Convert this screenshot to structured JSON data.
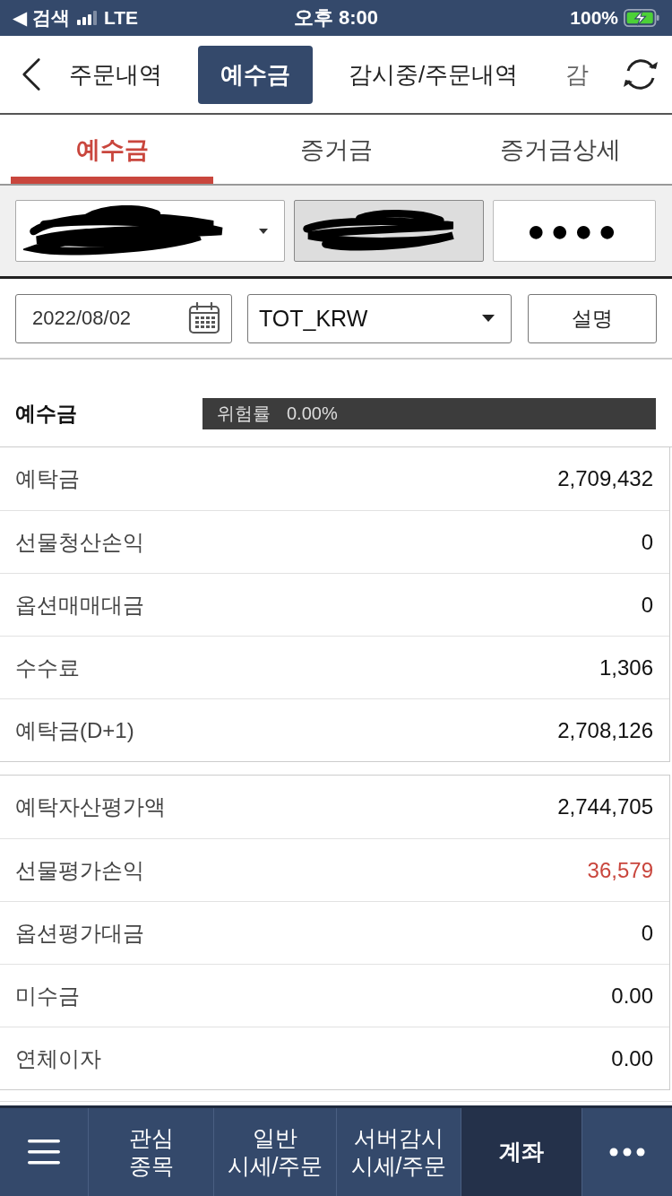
{
  "status_bar": {
    "back_label": "◀ 검색",
    "network": "LTE",
    "time": "오후 8:00",
    "battery": "100%"
  },
  "top_tabs": [
    {
      "label": "주문내역",
      "selected": false
    },
    {
      "label": "예수금",
      "selected": true
    },
    {
      "label": "감시중/주문내역",
      "selected": false
    },
    {
      "label": "감",
      "selected": false
    }
  ],
  "sub_tabs": [
    {
      "label": "예수금",
      "selected": true
    },
    {
      "label": "증거금",
      "selected": false
    },
    {
      "label": "증거금상세",
      "selected": false
    }
  ],
  "account": {
    "password": "●●●●"
  },
  "filters": {
    "date": "2022/08/02",
    "currency": "TOT_KRW",
    "help_button": "설명"
  },
  "summary": {
    "title": "예수금",
    "risk_label": "위험률",
    "risk_value": "0.00%"
  },
  "groups": [
    {
      "rows": [
        {
          "label": "예탁금",
          "value": "2,709,432",
          "color": "#111111"
        },
        {
          "label": "선물청산손익",
          "value": "0",
          "color": "#111111"
        },
        {
          "label": "옵션매매대금",
          "value": "0",
          "color": "#111111"
        },
        {
          "label": "수수료",
          "value": "1,306",
          "color": "#111111"
        },
        {
          "label": "예탁금(D+1)",
          "value": "2,708,126",
          "color": "#111111"
        }
      ]
    },
    {
      "rows": [
        {
          "label": "예탁자산평가액",
          "value": "2,744,705",
          "color": "#111111"
        },
        {
          "label": "선물평가손익",
          "value": "36,579",
          "color": "#c9463d"
        },
        {
          "label": "옵션평가대금",
          "value": "0",
          "color": "#111111"
        },
        {
          "label": "미수금",
          "value": "0.00",
          "color": "#111111"
        },
        {
          "label": "연체이자",
          "value": "0.00",
          "color": "#111111"
        }
      ]
    }
  ],
  "bottom_nav": [
    {
      "kind": "menu",
      "selected": false
    },
    {
      "kind": "text",
      "label": "관심\n종목",
      "selected": false
    },
    {
      "kind": "text",
      "label": "일반\n시세/주문",
      "selected": false
    },
    {
      "kind": "text",
      "label": "서버감시\n시세/주문",
      "selected": false
    },
    {
      "kind": "text",
      "label": "계좌",
      "selected": true
    },
    {
      "kind": "more",
      "selected": false
    }
  ]
}
